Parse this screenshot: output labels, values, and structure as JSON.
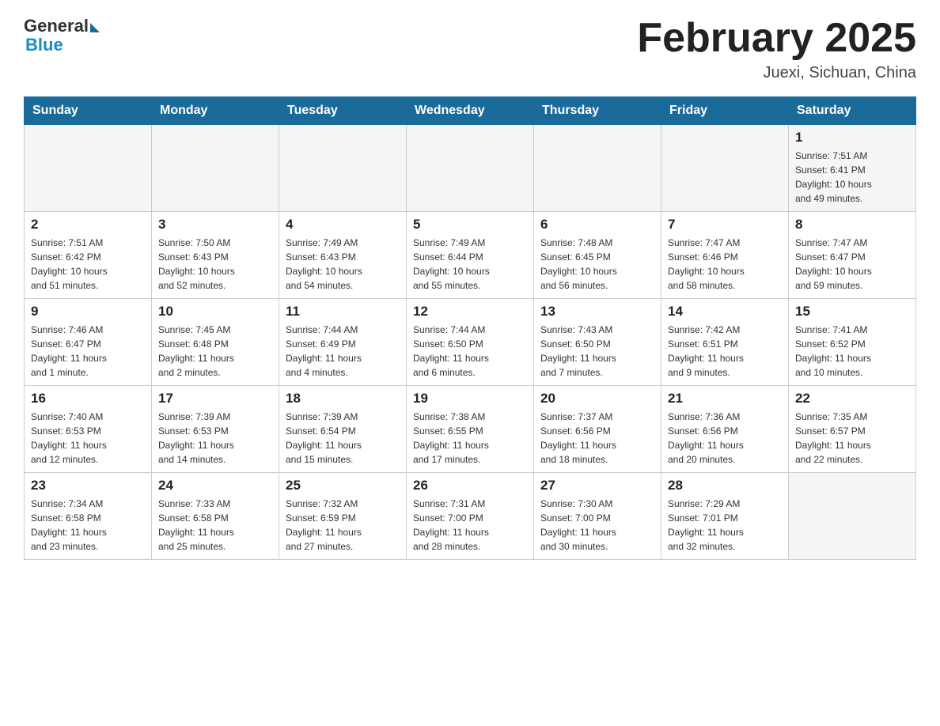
{
  "header": {
    "logo_text_general": "General",
    "logo_text_blue": "Blue",
    "title": "February 2025",
    "location": "Juexi, Sichuan, China"
  },
  "weekdays": [
    "Sunday",
    "Monday",
    "Tuesday",
    "Wednesday",
    "Thursday",
    "Friday",
    "Saturday"
  ],
  "weeks": [
    [
      {
        "day": "",
        "info": ""
      },
      {
        "day": "",
        "info": ""
      },
      {
        "day": "",
        "info": ""
      },
      {
        "day": "",
        "info": ""
      },
      {
        "day": "",
        "info": ""
      },
      {
        "day": "",
        "info": ""
      },
      {
        "day": "1",
        "info": "Sunrise: 7:51 AM\nSunset: 6:41 PM\nDaylight: 10 hours\nand 49 minutes."
      }
    ],
    [
      {
        "day": "2",
        "info": "Sunrise: 7:51 AM\nSunset: 6:42 PM\nDaylight: 10 hours\nand 51 minutes."
      },
      {
        "day": "3",
        "info": "Sunrise: 7:50 AM\nSunset: 6:43 PM\nDaylight: 10 hours\nand 52 minutes."
      },
      {
        "day": "4",
        "info": "Sunrise: 7:49 AM\nSunset: 6:43 PM\nDaylight: 10 hours\nand 54 minutes."
      },
      {
        "day": "5",
        "info": "Sunrise: 7:49 AM\nSunset: 6:44 PM\nDaylight: 10 hours\nand 55 minutes."
      },
      {
        "day": "6",
        "info": "Sunrise: 7:48 AM\nSunset: 6:45 PM\nDaylight: 10 hours\nand 56 minutes."
      },
      {
        "day": "7",
        "info": "Sunrise: 7:47 AM\nSunset: 6:46 PM\nDaylight: 10 hours\nand 58 minutes."
      },
      {
        "day": "8",
        "info": "Sunrise: 7:47 AM\nSunset: 6:47 PM\nDaylight: 10 hours\nand 59 minutes."
      }
    ],
    [
      {
        "day": "9",
        "info": "Sunrise: 7:46 AM\nSunset: 6:47 PM\nDaylight: 11 hours\nand 1 minute."
      },
      {
        "day": "10",
        "info": "Sunrise: 7:45 AM\nSunset: 6:48 PM\nDaylight: 11 hours\nand 2 minutes."
      },
      {
        "day": "11",
        "info": "Sunrise: 7:44 AM\nSunset: 6:49 PM\nDaylight: 11 hours\nand 4 minutes."
      },
      {
        "day": "12",
        "info": "Sunrise: 7:44 AM\nSunset: 6:50 PM\nDaylight: 11 hours\nand 6 minutes."
      },
      {
        "day": "13",
        "info": "Sunrise: 7:43 AM\nSunset: 6:50 PM\nDaylight: 11 hours\nand 7 minutes."
      },
      {
        "day": "14",
        "info": "Sunrise: 7:42 AM\nSunset: 6:51 PM\nDaylight: 11 hours\nand 9 minutes."
      },
      {
        "day": "15",
        "info": "Sunrise: 7:41 AM\nSunset: 6:52 PM\nDaylight: 11 hours\nand 10 minutes."
      }
    ],
    [
      {
        "day": "16",
        "info": "Sunrise: 7:40 AM\nSunset: 6:53 PM\nDaylight: 11 hours\nand 12 minutes."
      },
      {
        "day": "17",
        "info": "Sunrise: 7:39 AM\nSunset: 6:53 PM\nDaylight: 11 hours\nand 14 minutes."
      },
      {
        "day": "18",
        "info": "Sunrise: 7:39 AM\nSunset: 6:54 PM\nDaylight: 11 hours\nand 15 minutes."
      },
      {
        "day": "19",
        "info": "Sunrise: 7:38 AM\nSunset: 6:55 PM\nDaylight: 11 hours\nand 17 minutes."
      },
      {
        "day": "20",
        "info": "Sunrise: 7:37 AM\nSunset: 6:56 PM\nDaylight: 11 hours\nand 18 minutes."
      },
      {
        "day": "21",
        "info": "Sunrise: 7:36 AM\nSunset: 6:56 PM\nDaylight: 11 hours\nand 20 minutes."
      },
      {
        "day": "22",
        "info": "Sunrise: 7:35 AM\nSunset: 6:57 PM\nDaylight: 11 hours\nand 22 minutes."
      }
    ],
    [
      {
        "day": "23",
        "info": "Sunrise: 7:34 AM\nSunset: 6:58 PM\nDaylight: 11 hours\nand 23 minutes."
      },
      {
        "day": "24",
        "info": "Sunrise: 7:33 AM\nSunset: 6:58 PM\nDaylight: 11 hours\nand 25 minutes."
      },
      {
        "day": "25",
        "info": "Sunrise: 7:32 AM\nSunset: 6:59 PM\nDaylight: 11 hours\nand 27 minutes."
      },
      {
        "day": "26",
        "info": "Sunrise: 7:31 AM\nSunset: 7:00 PM\nDaylight: 11 hours\nand 28 minutes."
      },
      {
        "day": "27",
        "info": "Sunrise: 7:30 AM\nSunset: 7:00 PM\nDaylight: 11 hours\nand 30 minutes."
      },
      {
        "day": "28",
        "info": "Sunrise: 7:29 AM\nSunset: 7:01 PM\nDaylight: 11 hours\nand 32 minutes."
      },
      {
        "day": "",
        "info": ""
      }
    ]
  ]
}
